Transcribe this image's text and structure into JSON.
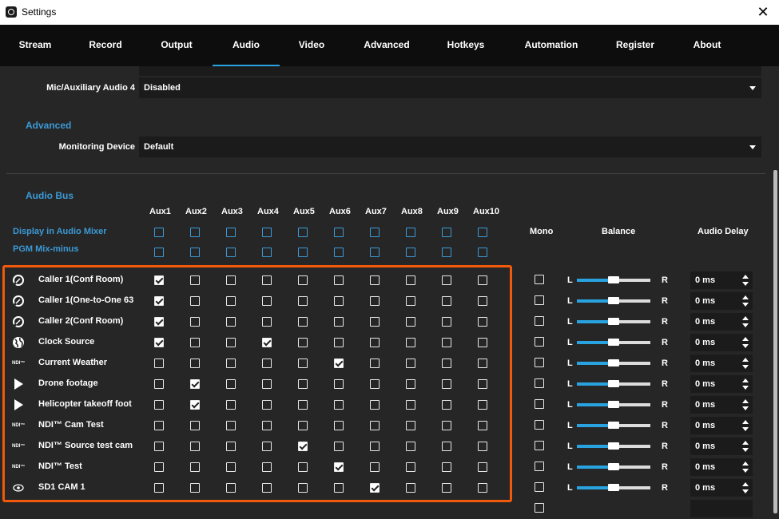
{
  "window": {
    "title": "Settings",
    "close_glyph": "✕"
  },
  "tabs": [
    {
      "label": "Stream"
    },
    {
      "label": "Record"
    },
    {
      "label": "Output"
    },
    {
      "label": "Audio"
    },
    {
      "label": "Video"
    },
    {
      "label": "Advanced"
    },
    {
      "label": "Hotkeys"
    },
    {
      "label": "Automation"
    },
    {
      "label": "Register"
    },
    {
      "label": "About"
    }
  ],
  "active_tab": "Audio",
  "mic4": {
    "label": "Mic/Auxiliary Audio 4",
    "value": "Disabled"
  },
  "advanced": {
    "heading": "Advanced",
    "monitoring_label": "Monitoring Device",
    "monitoring_value": "Default"
  },
  "audio_bus": {
    "heading": "Audio Bus",
    "aux_headers": [
      "Aux1",
      "Aux2",
      "Aux3",
      "Aux4",
      "Aux5",
      "Aux6",
      "Aux7",
      "Aux8",
      "Aux9",
      "Aux10"
    ],
    "display_label": "Display in Audio Mixer",
    "pgm_label": "PGM Mix-minus",
    "mono_header": "Mono",
    "balance_header": "Balance",
    "delay_header": "Audio Delay",
    "balance_left": "L",
    "balance_right": "R"
  },
  "sources": [
    {
      "name": "Caller 1(Conf Room)",
      "icon": "caller-icon",
      "aux": [
        1,
        0,
        0,
        0,
        0,
        0,
        0,
        0,
        0,
        0
      ],
      "mono": false,
      "balance": 0.5,
      "delay": "0 ms"
    },
    {
      "name": "Caller 1(One-to-One 63",
      "icon": "caller-icon",
      "aux": [
        1,
        0,
        0,
        0,
        0,
        0,
        0,
        0,
        0,
        0
      ],
      "mono": false,
      "balance": 0.5,
      "delay": "0 ms"
    },
    {
      "name": "Caller 2(Conf Room)",
      "icon": "caller-icon",
      "aux": [
        1,
        0,
        0,
        0,
        0,
        0,
        0,
        0,
        0,
        0
      ],
      "mono": false,
      "balance": 0.5,
      "delay": "0 ms"
    },
    {
      "name": "Clock Source",
      "icon": "globe-icon",
      "aux": [
        1,
        0,
        0,
        1,
        0,
        0,
        0,
        0,
        0,
        0
      ],
      "mono": false,
      "balance": 0.5,
      "delay": "0 ms"
    },
    {
      "name": "Current Weather",
      "icon": "ndi-icon",
      "aux": [
        0,
        0,
        0,
        0,
        0,
        1,
        0,
        0,
        0,
        0
      ],
      "mono": false,
      "balance": 0.5,
      "delay": "0 ms"
    },
    {
      "name": "Drone footage",
      "icon": "play-icon",
      "aux": [
        0,
        1,
        0,
        0,
        0,
        0,
        0,
        0,
        0,
        0
      ],
      "mono": false,
      "balance": 0.5,
      "delay": "0 ms"
    },
    {
      "name": "Helicopter takeoff foot",
      "icon": "play-icon",
      "aux": [
        0,
        1,
        0,
        0,
        0,
        0,
        0,
        0,
        0,
        0
      ],
      "mono": false,
      "balance": 0.5,
      "delay": "0 ms"
    },
    {
      "name": "NDI™ Cam Test",
      "icon": "ndi-icon",
      "aux": [
        0,
        0,
        0,
        0,
        0,
        0,
        0,
        0,
        0,
        0
      ],
      "mono": false,
      "balance": 0.5,
      "delay": "0 ms"
    },
    {
      "name": "NDI™ Source test cam",
      "icon": "ndi-icon",
      "aux": [
        0,
        0,
        0,
        0,
        1,
        0,
        0,
        0,
        0,
        0
      ],
      "mono": false,
      "balance": 0.5,
      "delay": "0 ms"
    },
    {
      "name": "NDI™ Test",
      "icon": "ndi-icon",
      "aux": [
        0,
        0,
        0,
        0,
        0,
        1,
        0,
        0,
        0,
        0
      ],
      "mono": false,
      "balance": 0.5,
      "delay": "0 ms"
    },
    {
      "name": "SD1 CAM 1",
      "icon": "eye-icon",
      "aux": [
        0,
        0,
        0,
        0,
        0,
        0,
        1,
        0,
        0,
        0
      ],
      "mono": false,
      "balance": 0.5,
      "delay": "0 ms"
    }
  ],
  "ndi_text": "NDI™",
  "colors": {
    "accent": "#29a3e0",
    "highlight": "#f05a0a",
    "section_blue": "#3b9ad6"
  }
}
